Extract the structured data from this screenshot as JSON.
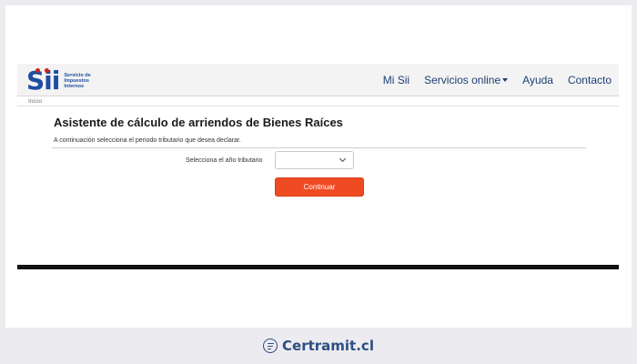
{
  "site": {
    "logo_mark": "Sii",
    "logo_lines": [
      "Servicio de",
      "Impuestos",
      "Internos"
    ]
  },
  "nav": {
    "items": [
      {
        "label": "Mi Sii",
        "has_dropdown": false
      },
      {
        "label": "Servicios online",
        "has_dropdown": true
      },
      {
        "label": "Ayuda",
        "has_dropdown": false
      },
      {
        "label": "Contacto",
        "has_dropdown": false
      }
    ]
  },
  "breadcrumb": "Inicio",
  "main": {
    "title": "Asistente de cálculo de arriendos de Bienes Raíces",
    "instructions": "A continuación selecciona el periodo tributario que desea declarar.",
    "year_label": "Selecciona el año tributario",
    "year_value": "",
    "continue_label": "Continuar"
  },
  "footer": {
    "brand": "Certramit.cl"
  },
  "colors": {
    "primary_blue": "#1e4ea1",
    "logo_red": "#d0221c",
    "button_orange": "#ef4b23",
    "footer_blue": "#2d4e82"
  }
}
